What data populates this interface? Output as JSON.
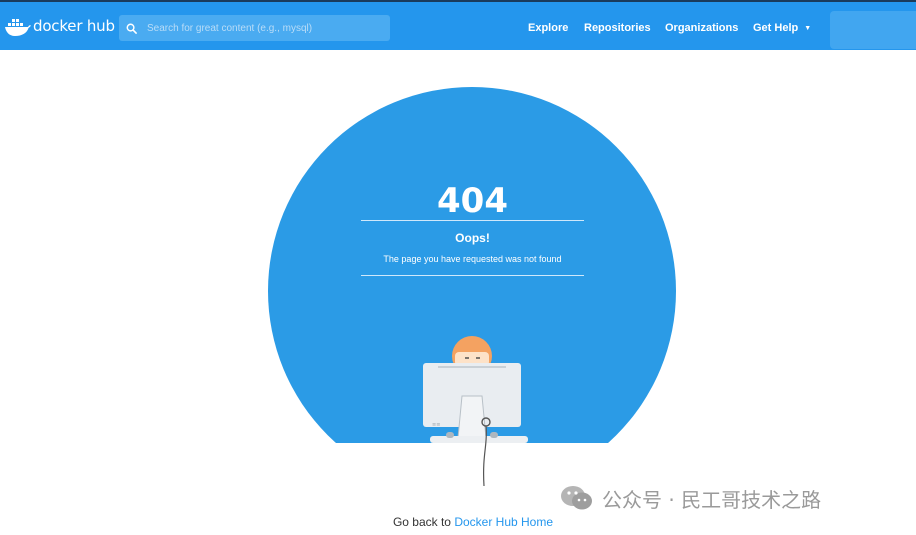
{
  "header": {
    "brand_text": "docker hub",
    "search_placeholder": "Search for great content (e.g., mysql)",
    "nav": {
      "explore": "Explore",
      "repositories": "Repositories",
      "organizations": "Organizations",
      "get_help": "Get Help"
    },
    "colors": {
      "bar": "#2496ed",
      "search_bg": "#4aabf1"
    }
  },
  "error": {
    "code": "404",
    "title": "Oops!",
    "message": "The page you have requested was not found",
    "circle_color": "#2b9be6"
  },
  "footer": {
    "back_prefix": "Go back to",
    "back_link": "Docker Hub Home"
  },
  "watermark": {
    "text": "公众号 · 民工哥技术之路"
  },
  "icons": {
    "logo": "docker-whale-icon",
    "search": "search-icon",
    "caret": "caret-down-icon",
    "wechat": "wechat-icon"
  }
}
